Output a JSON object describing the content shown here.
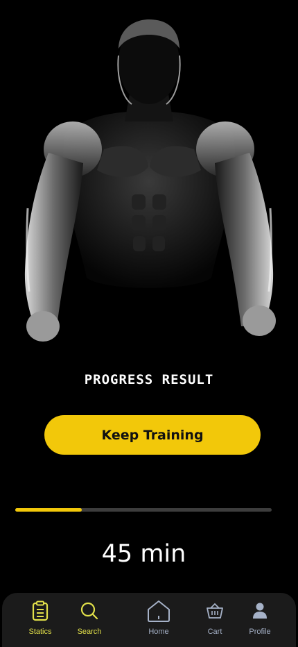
{
  "screen": {
    "title": "PROGRESS RESULT",
    "cta_label": "Keep Training",
    "progress": 0.26,
    "duration": "45 min"
  },
  "colors": {
    "accent": "#f2c80a",
    "active_nav": "#e2e04a",
    "inactive_nav": "#a6b2c8",
    "nav_bg": "#1b1b1b"
  },
  "nav": {
    "items": [
      {
        "label": "Statics",
        "icon": "clipboard-icon",
        "active": true
      },
      {
        "label": "Search",
        "icon": "search-icon",
        "active": true
      },
      {
        "label": "Home",
        "icon": "home-icon",
        "active": false
      },
      {
        "label": "Cart",
        "icon": "basket-icon",
        "active": false
      },
      {
        "label": "Profile",
        "icon": "person-icon",
        "active": false
      }
    ]
  }
}
